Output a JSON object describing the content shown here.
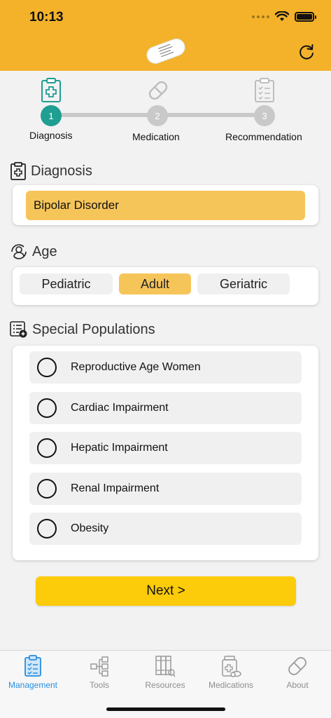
{
  "status": {
    "time": "10:13"
  },
  "stepper": {
    "steps": [
      {
        "number": "1",
        "label": "Diagnosis"
      },
      {
        "number": "2",
        "label": "Medication"
      },
      {
        "number": "3",
        "label": "Recommendation"
      }
    ],
    "active_step": 1
  },
  "diagnosis": {
    "title": "Diagnosis",
    "selected": "Bipolar Disorder"
  },
  "age": {
    "title": "Age",
    "options": [
      "Pediatric",
      "Adult",
      "Geriatric"
    ],
    "selected": "Adult"
  },
  "special_populations": {
    "title": "Special Populations",
    "items": [
      "Reproductive Age Women",
      "Cardiac Impairment",
      "Hepatic Impairment",
      "Renal Impairment",
      "Obesity"
    ]
  },
  "next_label": "Next >",
  "tabbar": {
    "tabs": [
      {
        "label": "Management",
        "icon": "clipboard-icon",
        "active": true
      },
      {
        "label": "Tools",
        "icon": "flowchart-icon",
        "active": false
      },
      {
        "label": "Resources",
        "icon": "books-icon",
        "active": false
      },
      {
        "label": "Medications",
        "icon": "pill-bottle-icon",
        "active": false
      },
      {
        "label": "About",
        "icon": "pill-icon",
        "active": false
      }
    ]
  },
  "colors": {
    "header": "#f3b22a",
    "accent_teal": "#1f9e92",
    "selected_fill": "#f6c55a",
    "next_button": "#fccb0a",
    "tab_active": "#2a8de0"
  }
}
